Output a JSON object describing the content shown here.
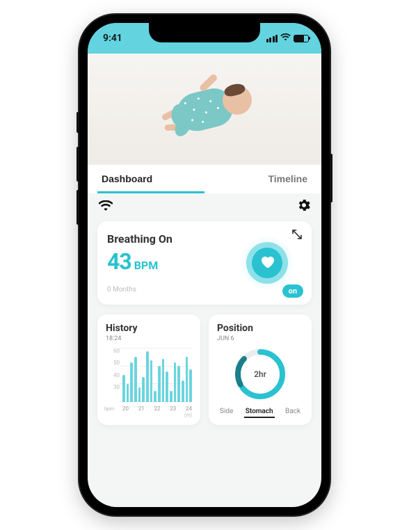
{
  "status": {
    "time": "9:41"
  },
  "tabs": {
    "dashboard": "Dashboard",
    "timeline": "Timeline",
    "active": "dashboard"
  },
  "breathing": {
    "title": "Breathing On",
    "value": "43",
    "unit": "BPM",
    "age": "0 Months",
    "toggle": "on"
  },
  "history": {
    "title": "History",
    "time": "18:24",
    "y_unit": "bpm",
    "x_unit": "(m)"
  },
  "position": {
    "title": "Position",
    "date": "JUN 6",
    "center": "2hr",
    "options": {
      "side": "Side",
      "stomach": "Stomach",
      "back": "Back"
    },
    "active": "stomach"
  },
  "chart_data": {
    "type": "bar",
    "title": "History",
    "xlabel": "(m)",
    "ylabel": "bpm",
    "ylim": [
      30,
      60
    ],
    "y_ticks": [
      60,
      50,
      40,
      30
    ],
    "x_ticks": [
      "20",
      "21",
      "22",
      "23",
      "24"
    ],
    "values": [
      45,
      40,
      52,
      55,
      38,
      44,
      58,
      53,
      36,
      50,
      54,
      47,
      36,
      52,
      50,
      42,
      55,
      48
    ]
  }
}
